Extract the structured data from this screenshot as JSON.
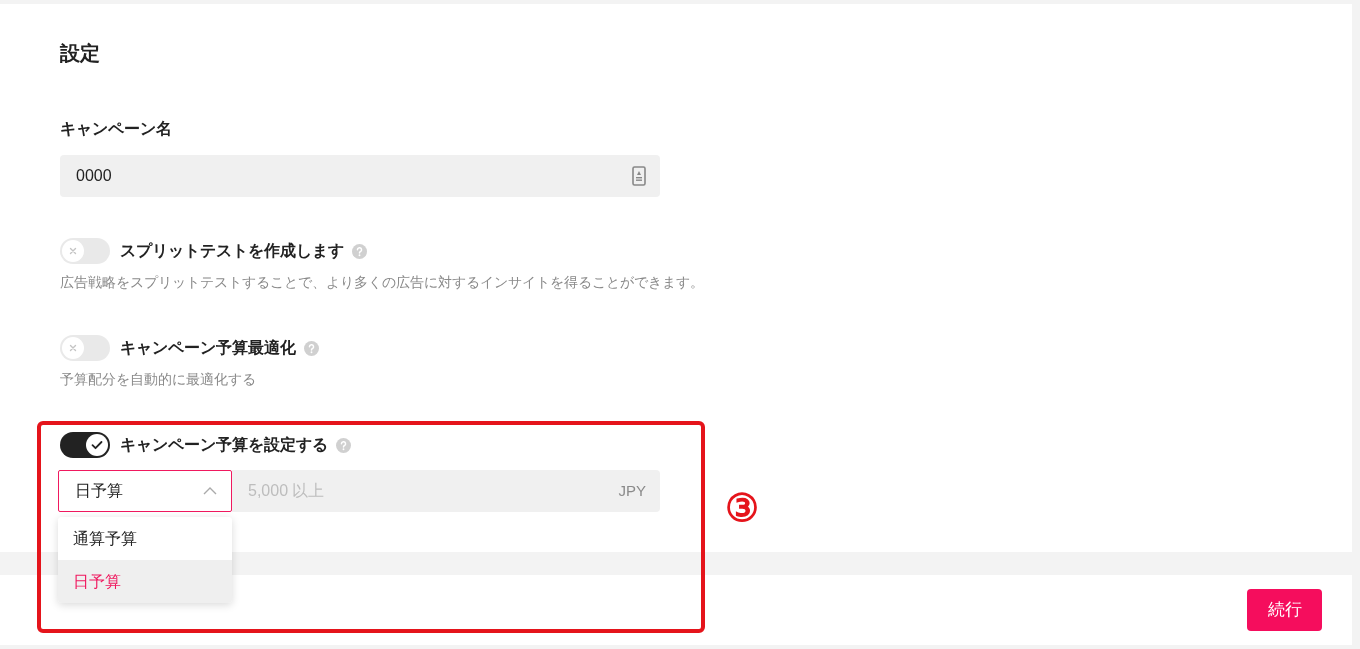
{
  "section": {
    "title": "設定"
  },
  "campaign_name": {
    "label": "キャンペーン名",
    "value": "0000"
  },
  "toggles": [
    {
      "label": "スプリットテストを作成します",
      "on": false,
      "description": "広告戦略をスプリットテストすることで、より多くの広告に対するインサイトを得ることができます。"
    },
    {
      "label": "キャンペーン予算最適化",
      "on": false,
      "description": "予算配分を自動的に最適化する"
    },
    {
      "label": "キャンペーン予算を設定する",
      "on": true
    }
  ],
  "budget": {
    "type": {
      "value": "日予算",
      "expanded": true,
      "options": [
        {
          "label": "通算予算",
          "selected": false
        },
        {
          "label": "日予算",
          "selected": true
        }
      ]
    },
    "amount": {
      "placeholder": "5,000 以上",
      "currency": "JPY"
    }
  },
  "annotation": {
    "label": "③"
  },
  "footer": {
    "buttons": [
      {
        "label": "続行"
      }
    ]
  }
}
